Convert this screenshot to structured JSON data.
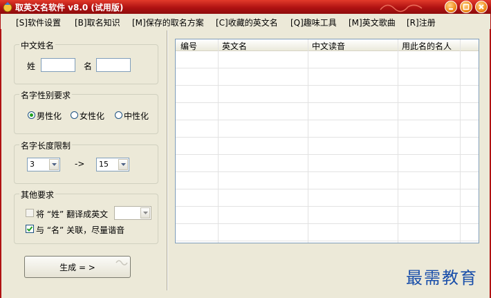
{
  "window": {
    "title": "取英文名软件 v8.0 (试用版)"
  },
  "menu": [
    {
      "label": "[S]软件设置"
    },
    {
      "label": "[B]取名知识"
    },
    {
      "label": "[M]保存的取名方案"
    },
    {
      "label": "[C]收藏的英文名"
    },
    {
      "label": "[Q]趣味工具"
    },
    {
      "label": "[M]英文歌曲"
    },
    {
      "label": "[R]注册"
    }
  ],
  "chinese_name": {
    "group_label": "中文姓名",
    "surname_label": "姓",
    "surname_value": "",
    "given_label": "名",
    "given_value": ""
  },
  "gender": {
    "group_label": "名字性别要求",
    "options": [
      "男性化",
      "女性化",
      "中性化"
    ],
    "selected": "男性化"
  },
  "length": {
    "group_label": "名字长度限制",
    "min": "3",
    "arrow": "->",
    "max": "15"
  },
  "other": {
    "group_label": "其他要求",
    "translate_surname": {
      "label": "将 “姓” 翻译成英文",
      "checked": false,
      "enabled": false,
      "value": ""
    },
    "relate_given": {
      "label": "与 “名” 关联，尽量谐音",
      "checked": true
    }
  },
  "generate_button": {
    "label": "生成 = >"
  },
  "table": {
    "columns": [
      "编号",
      "英文名",
      "中文读音",
      "用此名的名人"
    ],
    "rows": []
  },
  "watermark": "最需教育",
  "colors": {
    "title_bar": "#b01212",
    "panel": "#ece9d8",
    "watermark": "#1a4faa",
    "radio_dot": "#21a121"
  }
}
